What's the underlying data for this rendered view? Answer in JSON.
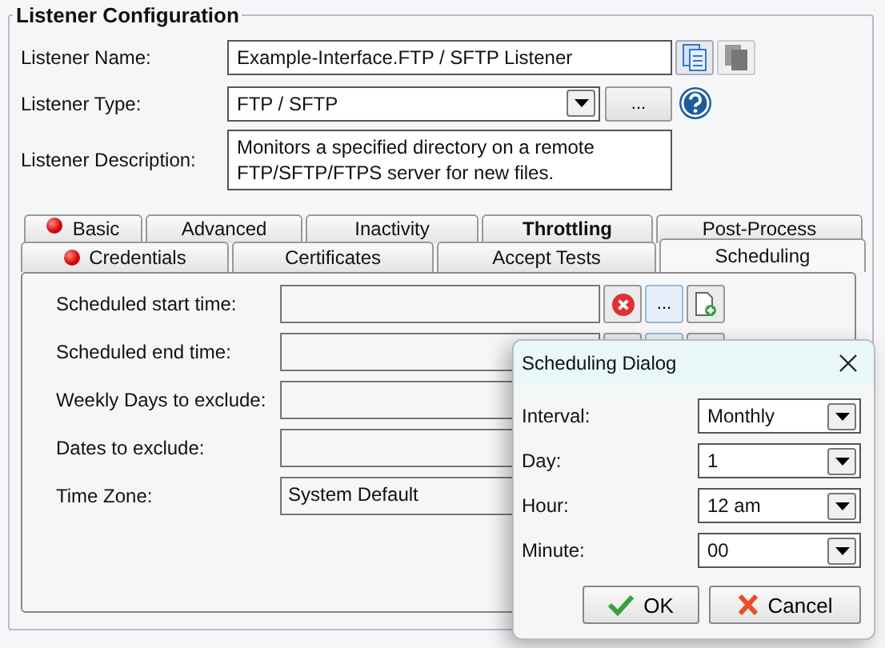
{
  "group": {
    "title": "Listener Configuration"
  },
  "listener": {
    "name_label": "Listener Name:",
    "name_value": "Example-Interface.FTP / SFTP Listener",
    "type_label": "Listener Type:",
    "type_value": "FTP / SFTP",
    "type_button": "...",
    "description_label": "Listener Description:",
    "description_value": "Monitors a specified directory on a remote FTP/SFTP/FTPS server for new files."
  },
  "tabs_row_1": [
    {
      "label": "Basic",
      "selected": false,
      "error": true,
      "bold": false
    },
    {
      "label": "Advanced",
      "selected": false,
      "error": false,
      "bold": false
    },
    {
      "label": "Inactivity",
      "selected": false,
      "error": false,
      "bold": false
    },
    {
      "label": "Throttling",
      "selected": false,
      "error": false,
      "bold": true
    },
    {
      "label": "Post-Process",
      "selected": false,
      "error": false,
      "bold": false
    }
  ],
  "tabs_row_2": [
    {
      "label": "Credentials",
      "selected": false,
      "error": true,
      "bold": false
    },
    {
      "label": "Certificates",
      "selected": false,
      "error": false,
      "bold": false
    },
    {
      "label": "Accept Tests",
      "selected": false,
      "error": false,
      "bold": false
    },
    {
      "label": "Scheduling",
      "selected": true,
      "error": false,
      "bold": false
    }
  ],
  "schedule_fields": [
    {
      "label": "Scheduled start time:",
      "kind": "date",
      "button_label": "..."
    },
    {
      "label": "Scheduled end time:",
      "kind": "date-covered"
    },
    {
      "label": "Weekly Days to exclude:",
      "kind": "text"
    },
    {
      "label": "Dates to exclude:",
      "kind": "text"
    },
    {
      "label": "Time Zone:",
      "kind": "text",
      "value": "System Default"
    }
  ],
  "dialog": {
    "title": "Scheduling Dialog",
    "fields": [
      {
        "label": "Interval:",
        "value": "Monthly"
      },
      {
        "label": "Day:",
        "value": "1"
      },
      {
        "label": "Hour:",
        "value": "12 am"
      },
      {
        "label": "Minute:",
        "value": "00"
      }
    ],
    "buttons": [
      {
        "label": "OK",
        "kind": "ok"
      },
      {
        "label": "Cancel",
        "kind": "cancel"
      }
    ]
  }
}
